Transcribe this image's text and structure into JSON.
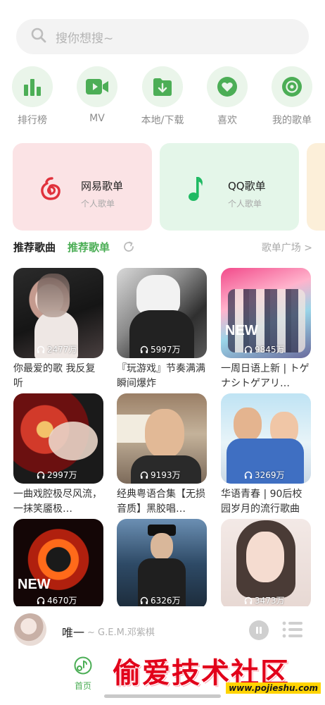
{
  "search": {
    "placeholder": "搜你想搜~"
  },
  "shortcuts": [
    {
      "label": "排行榜",
      "icon": "chart-bars-icon"
    },
    {
      "label": "MV",
      "icon": "video-camera-icon"
    },
    {
      "label": "本地/下载",
      "icon": "folder-download-icon"
    },
    {
      "label": "喜欢",
      "icon": "heart-icon"
    },
    {
      "label": "我的歌单",
      "icon": "disc-icon"
    }
  ],
  "playlist_cards": [
    {
      "title": "网易歌单",
      "subtitle": "个人歌单",
      "bg": "#fbe3e5",
      "icon": "netease-music-icon"
    },
    {
      "title": "QQ歌单",
      "subtitle": "个人歌单",
      "bg": "#e4f6e9",
      "icon": "qq-music-icon"
    }
  ],
  "section": {
    "tab_songs": "推荐歌曲",
    "tab_playlists": "推荐歌单",
    "plaza_link": "歌单广场 >"
  },
  "playlists": [
    {
      "plays": "2477万",
      "name": "你最爱的歌 我反复听"
    },
    {
      "plays": "5997万",
      "name": "『玩游戏』节奏满满 瞬间爆炸"
    },
    {
      "plays": "9845万",
      "name": "一周日语上新 | トゲナシトゲアリ…"
    },
    {
      "plays": "2997万",
      "name": "一曲戏腔极尽风流，一抹笑靥极…"
    },
    {
      "plays": "9193万",
      "name": "经典粤语合集【无损音质】黑胶唱…"
    },
    {
      "plays": "3269万",
      "name": "华语青春 | 90后校园岁月的流行歌曲"
    },
    {
      "plays": "4670万",
      "name": ""
    },
    {
      "plays": "6326万",
      "name": ""
    },
    {
      "plays": "3473万",
      "name": ""
    }
  ],
  "player": {
    "song": "唯一",
    "artist": "~ G.E.M.邓紫棋"
  },
  "nav": {
    "home_label": "首页"
  },
  "watermark": {
    "text": "偷爱技术社区",
    "url": "www.pojieshu.com"
  },
  "colors": {
    "accent": "#4cae56",
    "accent_light": "#eaf5ea"
  }
}
